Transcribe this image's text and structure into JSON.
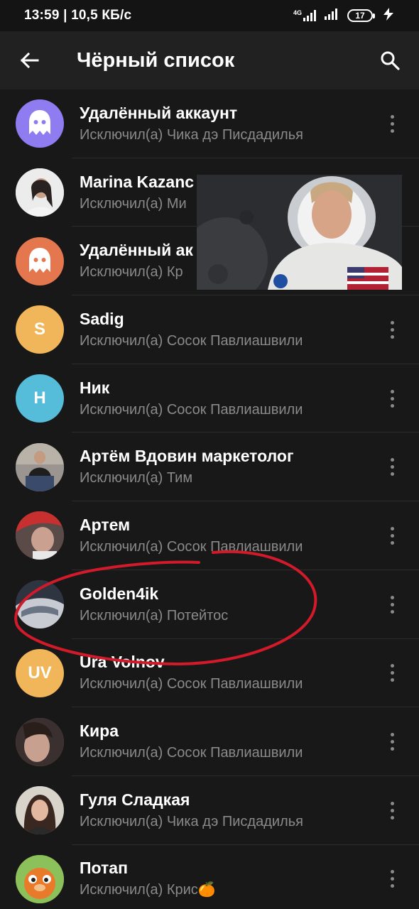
{
  "status_bar": {
    "time_speed": "13:59 | 10,5 КБ/с",
    "network": "4G",
    "battery": "17"
  },
  "header": {
    "title": "Чёрный список",
    "back_icon": "arrow-back-icon",
    "search_icon": "search-icon"
  },
  "colors": {
    "background": "#181818",
    "app_bar": "#212121",
    "annotation": "#d11a2a"
  },
  "contacts": [
    {
      "name": "Удалённый аккаунт",
      "subtitle": "Исключил(а) Чика дэ Писдадилья",
      "avatar": "ghost-icon",
      "color": "#8e7cf0"
    },
    {
      "name": "Marina Kazanc",
      "subtitle": "Исключил(а) Ми",
      "avatar": "photo-avatar",
      "color": "#dcdcdc"
    },
    {
      "name": "Удалённый ак",
      "subtitle": "Исключил(а) Кр",
      "avatar": "ghost-icon",
      "color": "#e4774e"
    },
    {
      "name": "Sadig",
      "subtitle": "Исключил(а) Сосок Павлиашвили",
      "initials": "S",
      "color": "#f2b65a"
    },
    {
      "name": "Ник",
      "subtitle": "Исключил(а) Сосок Павлиашвили",
      "initials": "Н",
      "color": "#55bcd9"
    },
    {
      "name": "Артём Вдовин маркетолог",
      "subtitle": "Исключил(а) Тим",
      "avatar": "photo-avatar",
      "color": "#6d6d6d"
    },
    {
      "name": "Артем",
      "subtitle": "Исключил(а) Сосок Павлиашвили",
      "avatar": "photo-avatar",
      "color": "#8a4a4a"
    },
    {
      "name": "Golden4ik",
      "subtitle": "Исключил(а) Потейтос",
      "avatar": "photo-avatar",
      "color": "#4a5566"
    },
    {
      "name": "Ura Volnov",
      "subtitle": "Исключил(а) Сосок Павлиашвили",
      "initials": "UV",
      "color": "#f2b65a"
    },
    {
      "name": "Кира",
      "subtitle": "Исключил(а) Сосок Павлиашвили",
      "avatar": "photo-avatar",
      "color": "#a07a6a"
    },
    {
      "name": "Гуля Сладкая",
      "subtitle": "Исключил(а) Чика дэ Писдадилья",
      "avatar": "photo-avatar",
      "color": "#7a6a5a"
    },
    {
      "name": "Потап",
      "subtitle": "Исключил(а) Крис🍊",
      "avatar": "photo-avatar",
      "color": "#7ab04a"
    }
  ]
}
